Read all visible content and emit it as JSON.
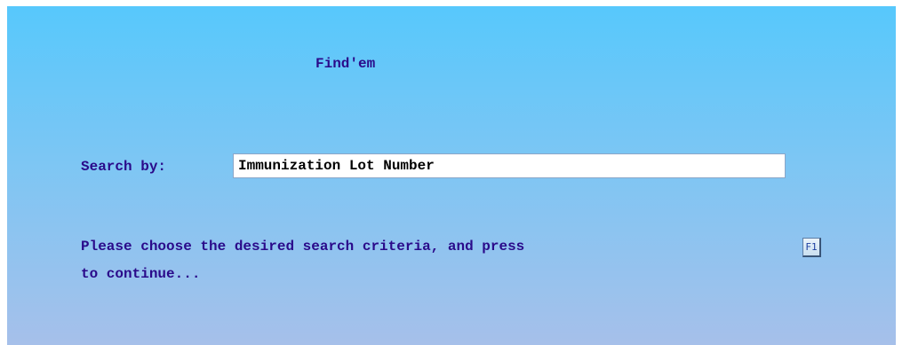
{
  "app": {
    "title": "Find'em"
  },
  "search": {
    "label": "Search by:",
    "value": "Immunization Lot Number"
  },
  "instructions": {
    "line1": "Please choose the desired search criteria, and press",
    "key_label": "F1",
    "line2": "to continue..."
  },
  "colors": {
    "text": "#2a0a8a",
    "background_top": "#57c8fc",
    "background_bottom": "#a6c0ea"
  }
}
